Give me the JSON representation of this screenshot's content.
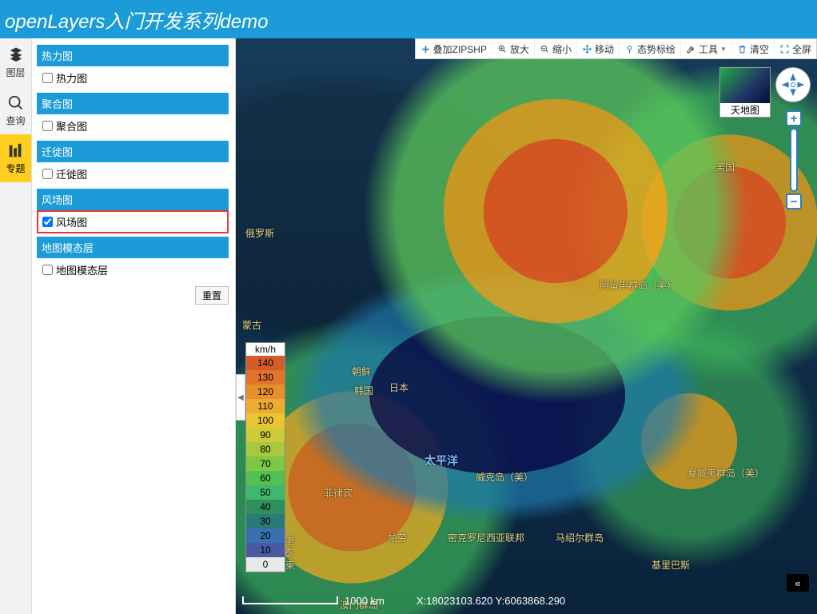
{
  "header": {
    "title": "openLayers入门开发系列demo"
  },
  "side_tabs": [
    {
      "id": "layers",
      "label": "图层"
    },
    {
      "id": "query",
      "label": "查询"
    },
    {
      "id": "theme",
      "label": "专题"
    }
  ],
  "layer_panel": {
    "sections": [
      {
        "header": "热力图",
        "item": "热力图",
        "checked": false
      },
      {
        "header": "聚合图",
        "item": "聚合图",
        "checked": false
      },
      {
        "header": "迁徙图",
        "item": "迁徙图",
        "checked": false
      },
      {
        "header": "风场图",
        "item": "风场图",
        "checked": true,
        "highlight": true
      },
      {
        "header": "地图模态层",
        "item": "地图模态层",
        "checked": false
      }
    ],
    "reset_label": "重置"
  },
  "toolbar": {
    "add_zip": "叠加ZIPSHP",
    "zoom_in": "放大",
    "zoom_out": "缩小",
    "pan": "移动",
    "situation": "态势标绘",
    "tools": "工具",
    "clear": "清空",
    "fullscreen": "全屏"
  },
  "minimap": {
    "label": "天地图"
  },
  "legend": {
    "unit": "km/h",
    "rows": [
      {
        "v": "140",
        "c": "#d75a2a"
      },
      {
        "v": "130",
        "c": "#e0742b"
      },
      {
        "v": "120",
        "c": "#e78f2d"
      },
      {
        "v": "110",
        "c": "#edab30"
      },
      {
        "v": "100",
        "c": "#e9c534"
      },
      {
        "v": "90",
        "c": "#cfca38"
      },
      {
        "v": "80",
        "c": "#a6c93e"
      },
      {
        "v": "70",
        "c": "#7cc746"
      },
      {
        "v": "60",
        "c": "#54c054"
      },
      {
        "v": "50",
        "c": "#3fb86b"
      },
      {
        "v": "40",
        "c": "#2f8f5d"
      },
      {
        "v": "30",
        "c": "#2a7a7a"
      },
      {
        "v": "20",
        "c": "#3a6fb0"
      },
      {
        "v": "10",
        "c": "#4a5aa0"
      },
      {
        "v": "0",
        "c": "#e8e8e8"
      }
    ]
  },
  "map_labels": {
    "russia": "俄罗斯",
    "mongolia": "蒙古",
    "korea_n": "朝鲜",
    "korea_s": "韩国",
    "japan": "日本",
    "usa": "美国",
    "aleutian": "阿留申群岛（美）",
    "pacific": "太平洋",
    "wake": "威克岛（美）",
    "hawaii": "夏威夷群岛（美）",
    "philippines": "菲律宾",
    "palau": "帕劳",
    "micronesia": "密克罗尼西亚联邦",
    "marshall": "马绍尔群岛",
    "kiribati": "基里巴斯",
    "laos": "老",
    "cambodia": "柬",
    "thailand": "泰",
    "macau2": "澳门群岛"
  },
  "scale": {
    "value": "1000 km"
  },
  "coords": {
    "text": "X:18023103.620 Y:6063868.290"
  },
  "expand_glyph": "«"
}
